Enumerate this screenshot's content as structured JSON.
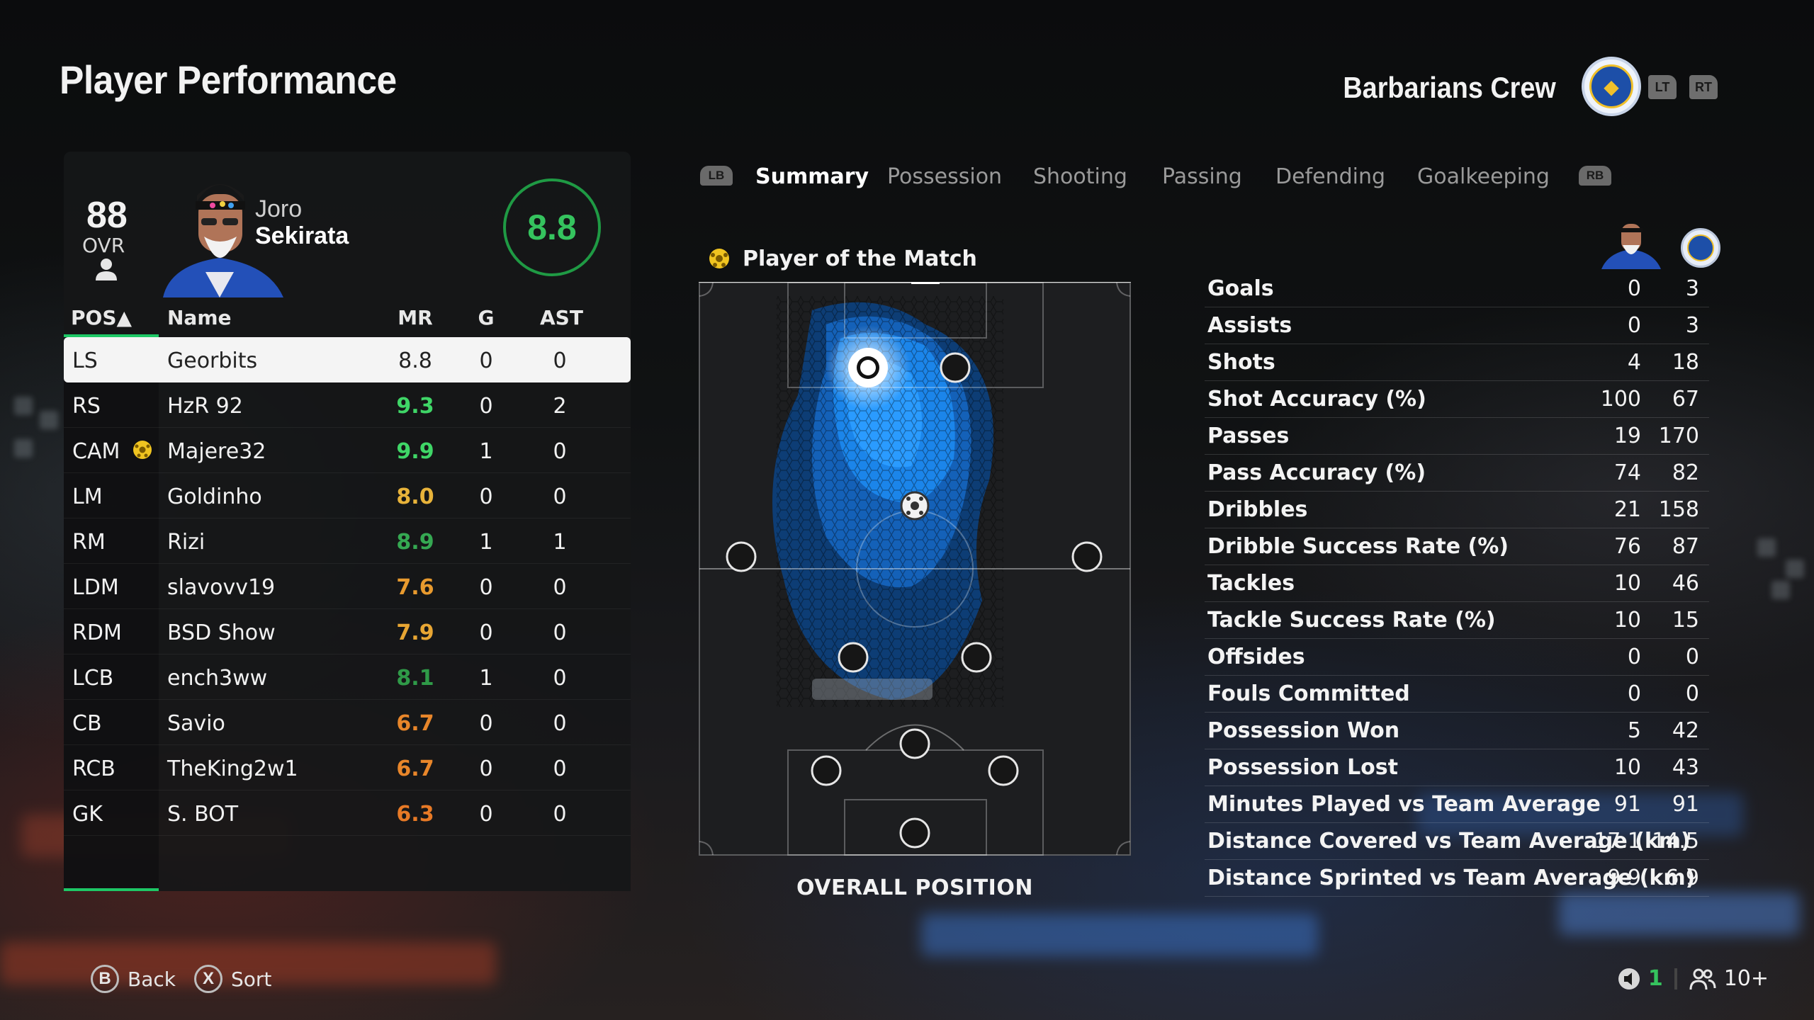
{
  "header": {
    "title": "Player Performance",
    "team_name": "Barbarians Crew",
    "trigger_left": "LT",
    "trigger_right": "RT"
  },
  "player": {
    "ovr": "88",
    "ovr_label": "OVR",
    "first_name": "Joro",
    "last_name": "Sekirata",
    "match_rating": "8.8"
  },
  "table": {
    "headers": {
      "pos": "POS▲",
      "name": "Name",
      "mr": "MR",
      "g": "G",
      "ast": "AST"
    },
    "rows": [
      {
        "pos": "LS",
        "name": "Georbits",
        "mr": "8.8",
        "g": "0",
        "ast": "0",
        "mr_color": "#222222",
        "selected": true
      },
      {
        "pos": "RS",
        "name": "HzR 92",
        "mr": "9.3",
        "g": "0",
        "ast": "2",
        "mr_color": "#3fd667"
      },
      {
        "pos": "CAM",
        "name": "Majere32",
        "mr": "9.9",
        "g": "1",
        "ast": "0",
        "mr_color": "#3fd667",
        "potm": true
      },
      {
        "pos": "LM",
        "name": "Goldinho",
        "mr": "8.0",
        "g": "0",
        "ast": "0",
        "mr_color": "#e8b33a"
      },
      {
        "pos": "RM",
        "name": "Rizi",
        "mr": "8.9",
        "g": "1",
        "ast": "1",
        "mr_color": "#35a852"
      },
      {
        "pos": "LDM",
        "name": "slavovv19",
        "mr": "7.6",
        "g": "0",
        "ast": "0",
        "mr_color": "#e89a2e"
      },
      {
        "pos": "RDM",
        "name": "BSD Show",
        "mr": "7.9",
        "g": "0",
        "ast": "0",
        "mr_color": "#e8a633"
      },
      {
        "pos": "LCB",
        "name": "ench3ww",
        "mr": "8.1",
        "g": "1",
        "ast": "0",
        "mr_color": "#2f9a48"
      },
      {
        "pos": "CB",
        "name": "Savio",
        "mr": "6.7",
        "g": "0",
        "ast": "0",
        "mr_color": "#e8862a"
      },
      {
        "pos": "RCB",
        "name": "TheKing2w1",
        "mr": "6.7",
        "g": "0",
        "ast": "0",
        "mr_color": "#e8862a"
      },
      {
        "pos": "GK",
        "name": "S. BOT",
        "mr": "6.3",
        "g": "0",
        "ast": "0",
        "mr_color": "#e87a26"
      }
    ]
  },
  "tabs": {
    "left_bumper": "LB",
    "right_bumper": "RB",
    "items": [
      "Summary",
      "Possession",
      "Shooting",
      "Passing",
      "Defending",
      "Goalkeeping"
    ],
    "active": "Summary"
  },
  "pitch": {
    "potm_label": "Player of the Match",
    "caption": "OVERALL POSITION"
  },
  "stats": [
    {
      "label": "Goals",
      "player": "0",
      "team": "3"
    },
    {
      "label": "Assists",
      "player": "0",
      "team": "3"
    },
    {
      "label": "Shots",
      "player": "4",
      "team": "18"
    },
    {
      "label": "Shot Accuracy (%)",
      "player": "100",
      "team": "67"
    },
    {
      "label": "Passes",
      "player": "19",
      "team": "170"
    },
    {
      "label": "Pass Accuracy (%)",
      "player": "74",
      "team": "82"
    },
    {
      "label": "Dribbles",
      "player": "21",
      "team": "158"
    },
    {
      "label": "Dribble Success Rate (%)",
      "player": "76",
      "team": "87"
    },
    {
      "label": "Tackles",
      "player": "10",
      "team": "46"
    },
    {
      "label": "Tackle Success Rate (%)",
      "player": "10",
      "team": "15"
    },
    {
      "label": "Offsides",
      "player": "0",
      "team": "0"
    },
    {
      "label": "Fouls Committed",
      "player": "0",
      "team": "0"
    },
    {
      "label": "Possession Won",
      "player": "5",
      "team": "42"
    },
    {
      "label": "Possession Lost",
      "player": "10",
      "team": "43"
    },
    {
      "label": "Minutes Played vs Team Average",
      "player": "91",
      "team": "91"
    },
    {
      "label": "Distance Covered vs Team Average (km)",
      "player": "17.1",
      "team": "14.5"
    },
    {
      "label": "Distance Sprinted vs Team Average (km)",
      "player": "9.9",
      "team": "6.9"
    }
  ],
  "footer": {
    "back_key": "B",
    "back_label": "Back",
    "sort_key": "X",
    "sort_label": "Sort",
    "mic_count": "1",
    "party_count": "10+"
  },
  "colors": {
    "accent_green": "#1ec866",
    "heatmap_blue": "#1a7fe0"
  }
}
